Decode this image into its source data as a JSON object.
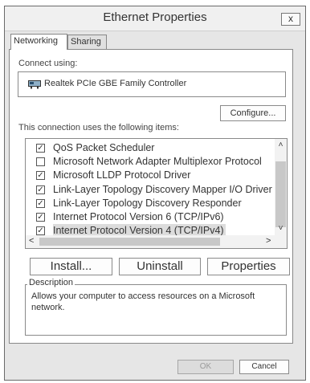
{
  "window": {
    "title": "Ethernet Properties",
    "close_label": "x"
  },
  "tabs": [
    {
      "label": "Networking"
    },
    {
      "label": "Sharing"
    }
  ],
  "connect_using": {
    "label": "Connect using:",
    "adapter": "Realtek PCIe GBE Family Controller",
    "adapter_icon": "network-adapter-icon"
  },
  "configure_label": "Configure...",
  "items_label": "This connection uses the following items:",
  "items": [
    {
      "label": "QoS Packet Scheduler",
      "checked": true
    },
    {
      "label": "Microsoft Network Adapter Multiplexor Protocol",
      "checked": false
    },
    {
      "label": "Microsoft LLDP Protocol Driver",
      "checked": true
    },
    {
      "label": "Link-Layer Topology Discovery Mapper I/O Driver",
      "checked": true
    },
    {
      "label": "Link-Layer Topology Discovery Responder",
      "checked": true
    },
    {
      "label": "Internet Protocol Version 6 (TCP/IPv6)",
      "checked": true
    },
    {
      "label": "Internet Protocol Version 4 (TCP/IPv4)",
      "checked": true,
      "selected": true
    }
  ],
  "buttons": {
    "install": "Install...",
    "uninstall": "Uninstall",
    "properties": "Properties"
  },
  "description": {
    "legend": "Description",
    "text": "Allows your computer to access resources on a Microsoft network."
  },
  "footer": {
    "ok": "OK",
    "cancel": "Cancel"
  },
  "colors": {
    "window_bg": "#e6e6e6",
    "selection": "#dcdcdc",
    "disabled_text": "#9a9a9a"
  }
}
